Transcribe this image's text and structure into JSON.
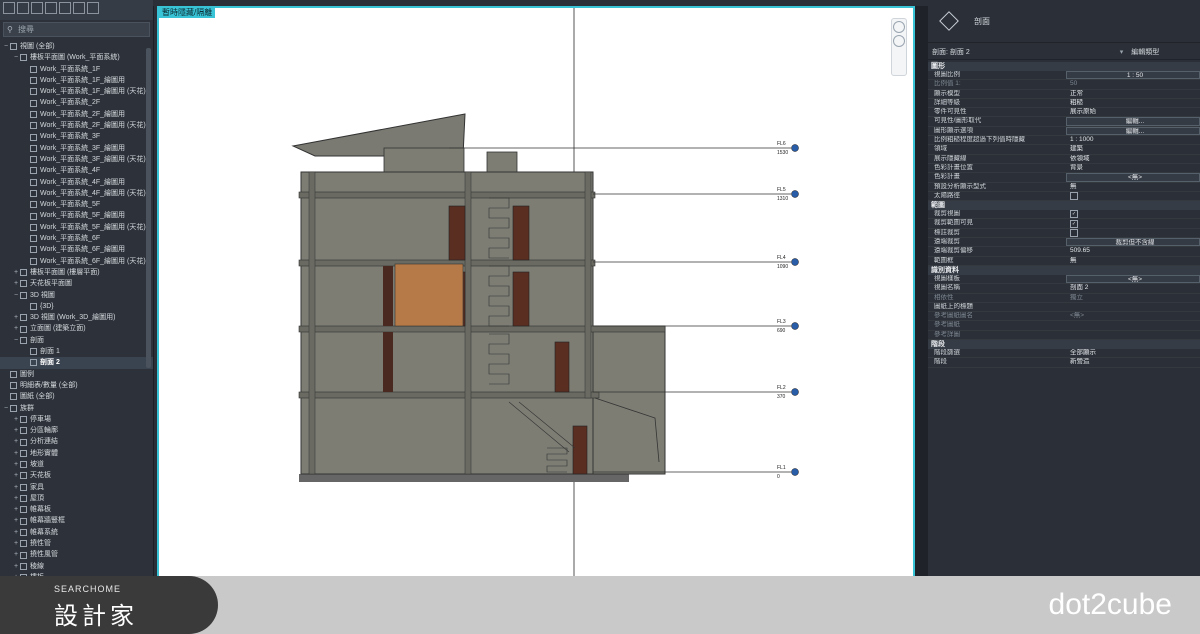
{
  "browser": {
    "search_placeholder": "搜尋",
    "items": [
      {
        "label": "視圖 (全部)",
        "tog": "−"
      },
      {
        "label": "樓板平面圖 (Work_平面系統)",
        "tog": "−"
      },
      {
        "label": "Work_平面系統_1F",
        "tog": ""
      },
      {
        "label": "Work_平面系統_1F_繪圖用",
        "tog": ""
      },
      {
        "label": "Work_平面系統_1F_繪圖用 (天花)",
        "tog": ""
      },
      {
        "label": "Work_平面系統_2F",
        "tog": ""
      },
      {
        "label": "Work_平面系統_2F_繪圖用",
        "tog": ""
      },
      {
        "label": "Work_平面系統_2F_繪圖用 (天花)",
        "tog": ""
      },
      {
        "label": "Work_平面系統_3F",
        "tog": ""
      },
      {
        "label": "Work_平面系統_3F_繪圖用",
        "tog": ""
      },
      {
        "label": "Work_平面系統_3F_繪圖用 (天花)",
        "tog": ""
      },
      {
        "label": "Work_平面系統_4F",
        "tog": ""
      },
      {
        "label": "Work_平面系統_4F_繪圖用",
        "tog": ""
      },
      {
        "label": "Work_平面系統_4F_繪圖用 (天花)",
        "tog": ""
      },
      {
        "label": "Work_平面系統_5F",
        "tog": ""
      },
      {
        "label": "Work_平面系統_5F_繪圖用",
        "tog": ""
      },
      {
        "label": "Work_平面系統_5F_繪圖用 (天花)",
        "tog": ""
      },
      {
        "label": "Work_平面系統_6F",
        "tog": ""
      },
      {
        "label": "Work_平面系統_6F_繪圖用",
        "tog": ""
      },
      {
        "label": "Work_平面系統_6F_繪圖用 (天花)",
        "tog": ""
      },
      {
        "label": "樓板平面圖 (樓層平面)",
        "tog": "+"
      },
      {
        "label": "天花板平面圖",
        "tog": "+"
      },
      {
        "label": "3D 視圖",
        "tog": "−"
      },
      {
        "label": "{3D}",
        "tog": ""
      },
      {
        "label": "3D 視圖 (Work_3D_繪圖用)",
        "tog": "+"
      },
      {
        "label": "立面圖 (建築立面)",
        "tog": "+"
      },
      {
        "label": "剖面",
        "tog": "−"
      },
      {
        "label": "剖面 1",
        "tog": ""
      },
      {
        "label": "剖面 2",
        "tog": "",
        "selected": true
      },
      {
        "label": "圖例",
        "tog": ""
      },
      {
        "label": "明細表/數量 (全部)",
        "tog": ""
      },
      {
        "label": "圖紙 (全部)",
        "tog": ""
      },
      {
        "label": "族群",
        "tog": "−"
      },
      {
        "label": "停車場",
        "tog": "+"
      },
      {
        "label": "分區輪廓",
        "tog": "+"
      },
      {
        "label": "分析連結",
        "tog": "+"
      },
      {
        "label": "地形實體",
        "tog": "+"
      },
      {
        "label": "坡道",
        "tog": "+"
      },
      {
        "label": "天花板",
        "tog": "+"
      },
      {
        "label": "家具",
        "tog": "+"
      },
      {
        "label": "屋頂",
        "tog": "+"
      },
      {
        "label": "帷幕板",
        "tog": "+"
      },
      {
        "label": "帷幕牆豎框",
        "tog": "+"
      },
      {
        "label": "帷幕系統",
        "tog": "+"
      },
      {
        "label": "撓性管",
        "tog": "+"
      },
      {
        "label": "撓性風管",
        "tog": "+"
      },
      {
        "label": "稜線",
        "tog": "+"
      },
      {
        "label": "樓板",
        "tog": "+"
      }
    ]
  },
  "canvas": {
    "tag": "暫時隱藏/隔離",
    "levels": [
      {
        "name": "FL6",
        "elev": "1530"
      },
      {
        "name": "FL5",
        "elev": "1310"
      },
      {
        "name": "FL4",
        "elev": "1090"
      },
      {
        "name": "FL3",
        "elev": "690"
      },
      {
        "name": "FL2",
        "elev": "370"
      },
      {
        "name": "FL1",
        "elev": "0"
      }
    ]
  },
  "props": {
    "header": "剖面",
    "selector": "剖面: 剖面 2",
    "edit_type": "編輯類型",
    "sections": [
      {
        "title": "圖形",
        "rows": [
          {
            "k": "視圖比例",
            "v": "1 : 50",
            "style": "box"
          },
          {
            "k": "比例值 1:",
            "v": "50",
            "dim": true
          },
          {
            "k": "顯示模型",
            "v": "正常"
          },
          {
            "k": "詳細等級",
            "v": "粗糙"
          },
          {
            "k": "零件可見性",
            "v": "展示原始"
          },
          {
            "k": "可見性/圖形取代",
            "v": "編輯...",
            "style": "box"
          },
          {
            "k": "圖形顯示選項",
            "v": "編輯...",
            "style": "box"
          },
          {
            "k": "比例粗糙程度超過下列值時隱藏",
            "v": "1 : 1000"
          },
          {
            "k": "領域",
            "v": "建築"
          },
          {
            "k": "展示隱藏線",
            "v": "依領域"
          },
          {
            "k": "色彩計畫位置",
            "v": "背景"
          },
          {
            "k": "色彩計畫",
            "v": "<無>",
            "style": "box"
          },
          {
            "k": "預設分析顯示型式",
            "v": "無"
          },
          {
            "k": "太陽路徑",
            "v": "",
            "style": "chk",
            "checked": false
          }
        ]
      },
      {
        "title": "範圍",
        "rows": [
          {
            "k": "裁剪視圖",
            "v": "",
            "style": "chk",
            "checked": true
          },
          {
            "k": "裁剪範圍可見",
            "v": "",
            "style": "chk",
            "checked": true
          },
          {
            "k": "標註裁剪",
            "v": "",
            "style": "chk",
            "checked": false
          },
          {
            "k": "遠端裁剪",
            "v": "裁剪但不含線",
            "style": "box"
          },
          {
            "k": "遠端裁剪偏移",
            "v": "509.65"
          },
          {
            "k": "範圍框",
            "v": "無"
          }
        ]
      },
      {
        "title": "識別資料",
        "rows": [
          {
            "k": "視圖樣板",
            "v": "<無>",
            "style": "box"
          },
          {
            "k": "視圖名稱",
            "v": "剖面 2"
          },
          {
            "k": "相依性",
            "v": "獨立",
            "dim": true
          },
          {
            "k": "圖紙上的標題",
            "v": ""
          },
          {
            "k": "參考圖紙圖名",
            "v": "<無>",
            "dim": true
          },
          {
            "k": "參考圖紙",
            "v": "",
            "dim": true
          },
          {
            "k": "參考詳圖",
            "v": "",
            "dim": true
          }
        ]
      },
      {
        "title": "階段",
        "rows": [
          {
            "k": "階段篩選",
            "v": "全部顯示"
          },
          {
            "k": "階段",
            "v": "新營造"
          }
        ]
      }
    ]
  },
  "banner": {
    "logo_small": "SEARCHOME",
    "logo_big": "設計家",
    "brand": "dot2cube"
  }
}
